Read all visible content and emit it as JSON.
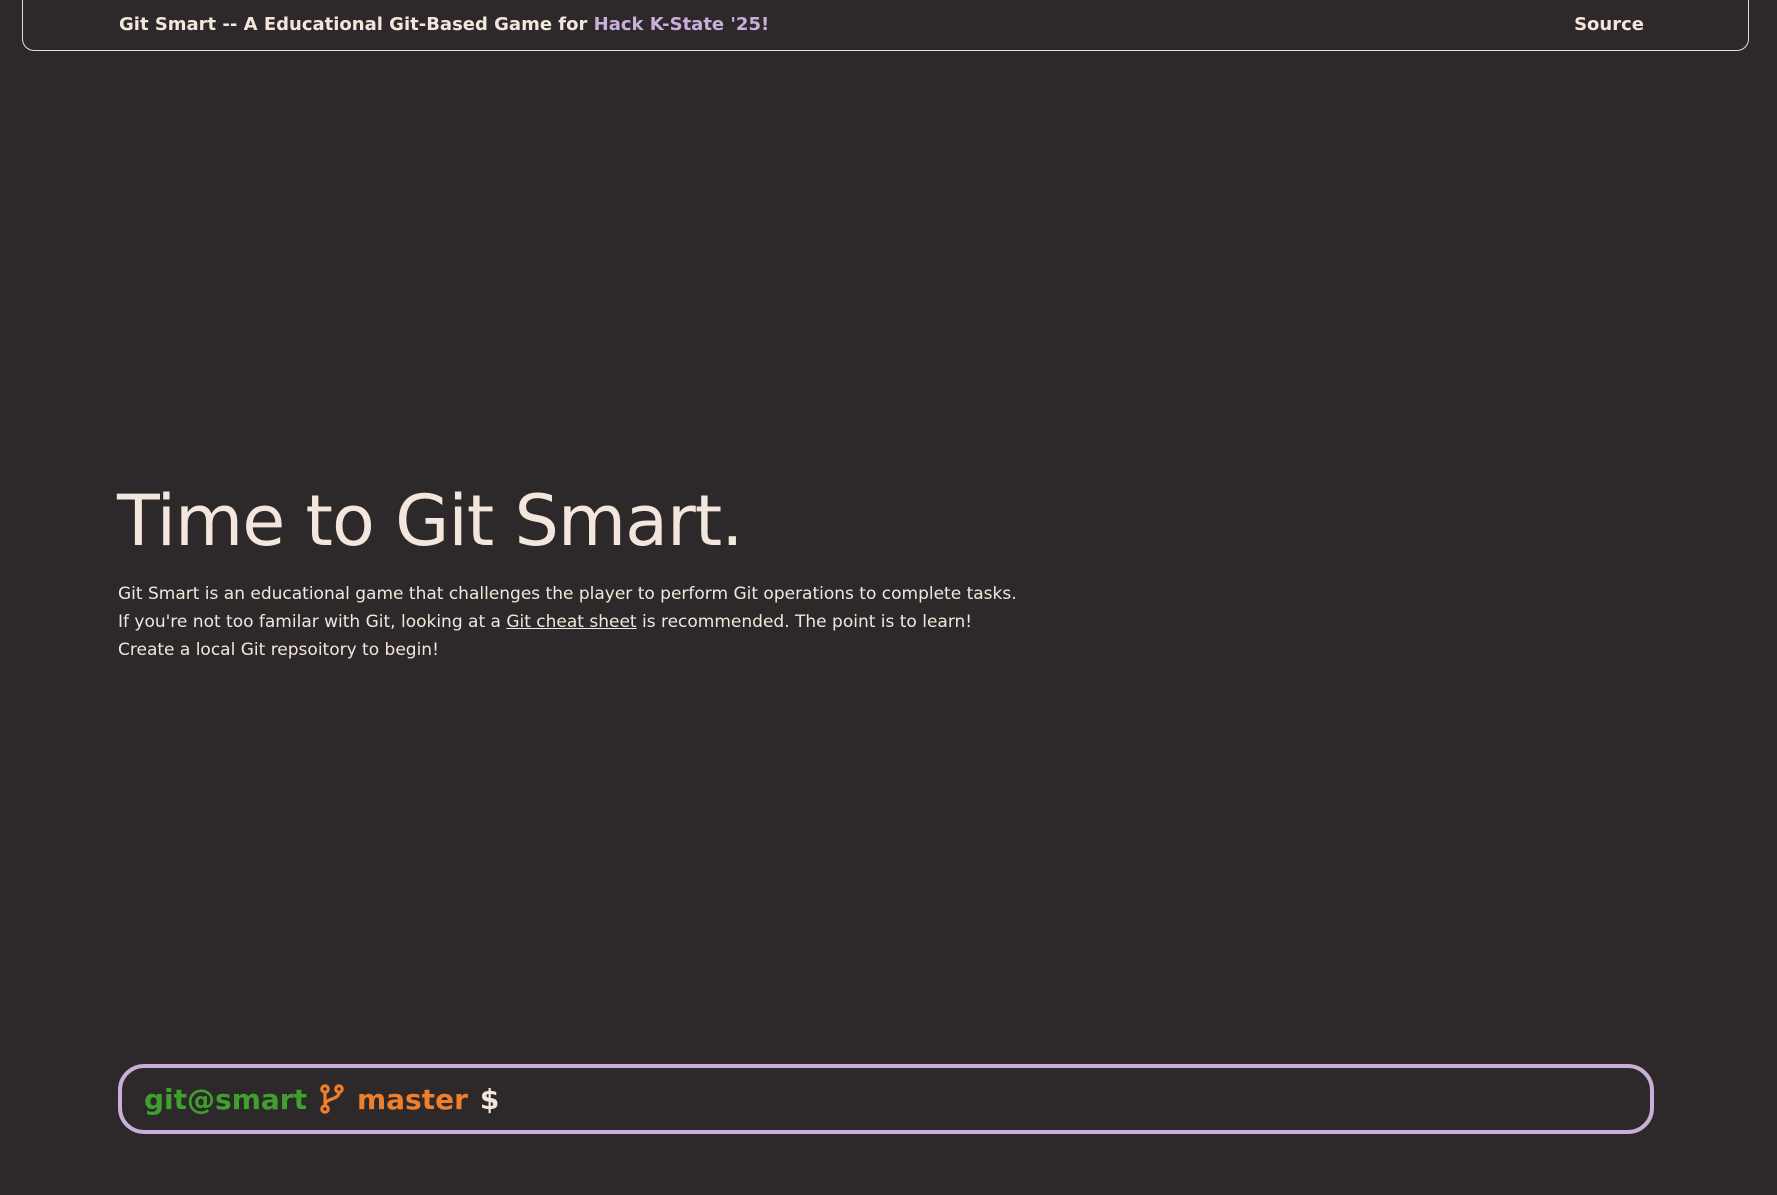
{
  "nav": {
    "title_prefix": "Git Smart -- A Educational Git-Based Game for ",
    "title_accent": "Hack K-State '25!",
    "source_label": "Source"
  },
  "hero": {
    "title": "Time to Git Smart.",
    "desc_part1": "Git Smart is an educational game that challenges the player to perform Git operations to complete tasks. If you're not too familar with Git, looking at a ",
    "desc_link": "Git cheat sheet",
    "desc_part2": " is recommended. The point is to learn! Create a local Git repsoitory to begin!"
  },
  "terminal": {
    "user_host": "git@smart",
    "branch_icon": "git-branch-icon",
    "branch": "master",
    "dollar": "$",
    "input_value": ""
  },
  "colors": {
    "background": "#2d2829",
    "text": "#f3e6dc",
    "accent_purple": "#c9aede",
    "prompt_green": "#3fa12d",
    "prompt_orange": "#f07f2c",
    "terminal_border": "#c9aed6"
  }
}
